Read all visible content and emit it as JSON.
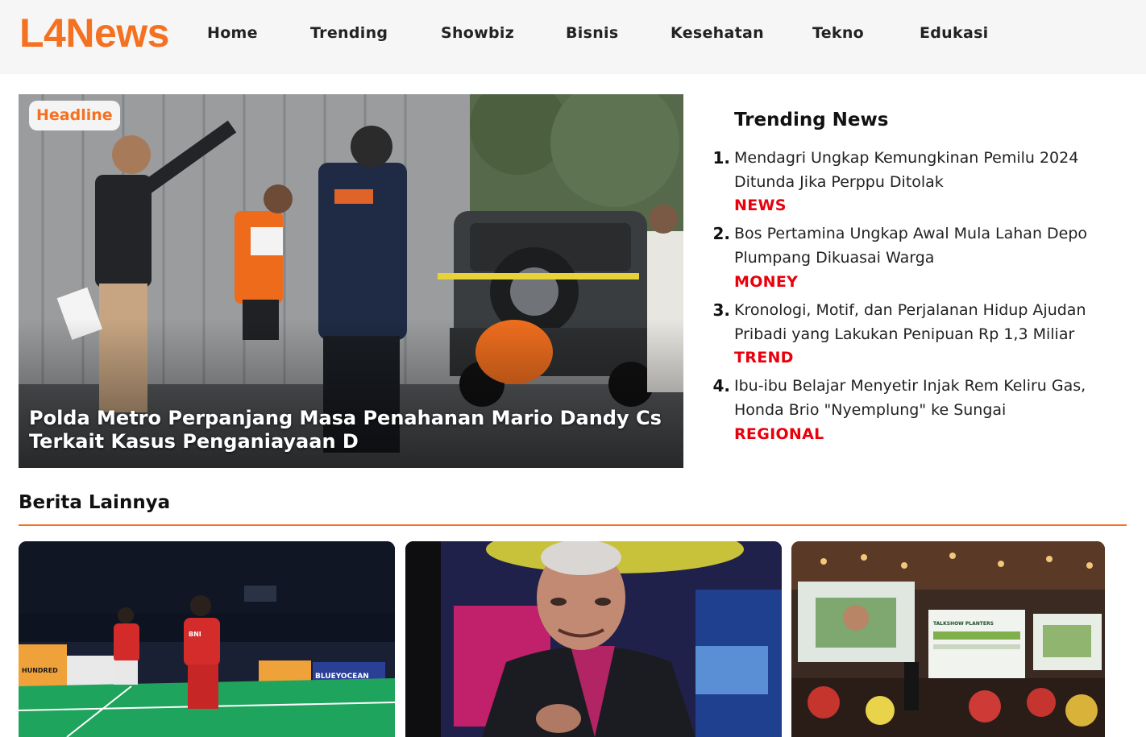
{
  "brand": {
    "logo_text": "L4News",
    "accent_color": "#f57122",
    "category_color": "#e8000b"
  },
  "nav": {
    "items": [
      {
        "label": "Home"
      },
      {
        "label": "Trending"
      },
      {
        "label": "Showbiz"
      },
      {
        "label": "Bisnis"
      },
      {
        "label": "Kesehatan"
      },
      {
        "label": "Tekno"
      },
      {
        "label": "Edukasi"
      }
    ]
  },
  "headline": {
    "badge": "Headline",
    "title": "Polda Metro Perpanjang Masa Penahanan Mario Dandy Cs Terkait Kasus Penganiayaan D",
    "image": "crime-scene-reconstruction-photo"
  },
  "trending": {
    "heading": "Trending News",
    "items": [
      {
        "number": "1.",
        "title": "Mendagri Ungkap Kemungkinan Pemilu 2024 Ditunda Jika Perppu Ditolak",
        "category": "NEWS"
      },
      {
        "number": "2.",
        "title": "Bos Pertamina Ungkap Awal Mula Lahan Depo Plumpang Dikuasai Warga",
        "category": "MONEY"
      },
      {
        "number": "3.",
        "title": "Kronologi, Motif, dan Perjalanan Hidup Ajudan Pribadi yang Lakukan Penipuan Rp 1,3 Miliar",
        "category": "TREND"
      },
      {
        "number": "4.",
        "title": "Ibu-ibu Belajar Menyetir Injak Rem Keliru Gas, Honda Brio \"Nyemplung\" ke Sungai",
        "category": "REGIONAL"
      }
    ]
  },
  "more_news": {
    "heading": "Berita Lainnya",
    "cards": [
      {
        "image": "badminton-doubles-photo",
        "board_text": [
          "HUNDRED",
          "BLUEYOCEAN",
          "BNI"
        ]
      },
      {
        "image": "man-portrait-stage-photo"
      },
      {
        "image": "talkshow-conference-photo",
        "banner_text": "TALKSHOW PLANTERS"
      }
    ]
  }
}
